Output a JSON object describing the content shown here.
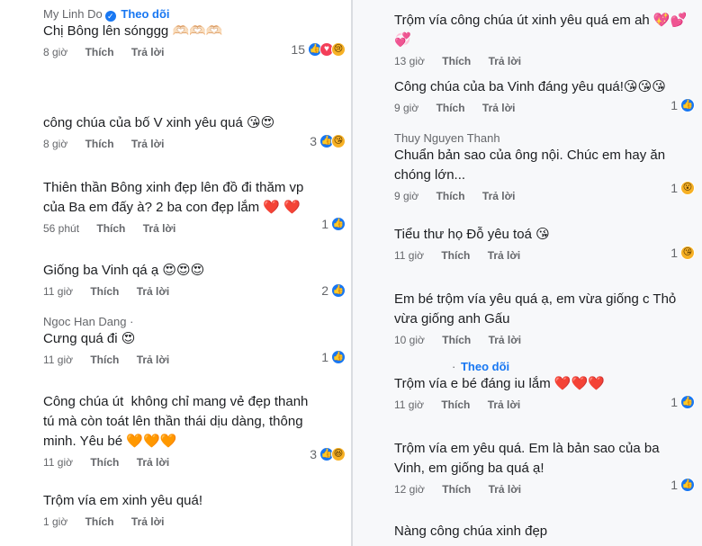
{
  "left": [
    {
      "author": "My Linh Do",
      "verified": true,
      "follow": "Theo dõi",
      "text": "Chị Bông lên sónggg 🫶🏻🫶🏻🫶🏻",
      "time": "8 giờ",
      "like": "Thích",
      "reply": "Trả lời",
      "reaction_count": "15",
      "reactions": [
        "like-icon",
        "love-icon",
        "sad-icon"
      ]
    },
    {
      "text": "công chúa của bố V xinh yêu quá 😘😍",
      "time": "8 giờ",
      "like": "Thích",
      "reply": "Trả lời",
      "reaction_count": "3",
      "reactions": [
        "like-icon",
        "kiss-icon"
      ]
    },
    {
      "text": "Thiên thần Bông xinh đẹp lên đồ đi thăm vp của Ba em đấy à? 2 ba con đẹp lắm ❤️ ❤️",
      "time": "56 phút",
      "like": "Thích",
      "reply": "Trả lời",
      "reaction_count": "1",
      "reactions": [
        "like-icon"
      ]
    },
    {
      "text": "Giống ba Vinh qá ạ 😍😍😍",
      "time": "11 giờ",
      "like": "Thích",
      "reply": "Trả lời",
      "reaction_count": "2",
      "reactions": [
        "like-icon"
      ]
    },
    {
      "author": "Ngoc Han Dang",
      "dot": "·",
      "text": "Cưng quá đi 😍",
      "time": "11 giờ",
      "like": "Thích",
      "reply": "Trả lời",
      "reaction_count": "1",
      "reactions": [
        "like-icon"
      ]
    },
    {
      "text": "Công chúa út  không chỉ mang vẻ đẹp thanh tú mà còn toát lên thần thái dịu dàng, thông minh. Yêu bé 🧡🧡🧡",
      "time": "11 giờ",
      "like": "Thích",
      "reply": "Trả lời",
      "reaction_count": "3",
      "reactions": [
        "like-icon",
        "laugh-icon"
      ]
    },
    {
      "text": "Trộm vía em xinh yêu quá!",
      "time": "1 giờ",
      "like": "Thích",
      "reply": "Trả lời"
    }
  ],
  "right": [
    {
      "text": "Trộm vía công chúa út xinh yêu quá em ah 💖💕💞",
      "time": "13 giờ",
      "like": "Thích",
      "reply": "Trả lời"
    },
    {
      "text": "Công chúa của ba Vinh đáng yêu quá!😘😘😘",
      "time": "9 giờ",
      "like": "Thích",
      "reply": "Trả lời",
      "reaction_count": "1",
      "reactions": [
        "like-icon"
      ]
    },
    {
      "author": "Thuy Nguyen Thanh",
      "text": "Chuẩn bản sao của ông nội. Chúc em hay ăn chóng lớn...",
      "time": "9 giờ",
      "like": "Thích",
      "reply": "Trả lời",
      "reaction_count": "1",
      "reactions": [
        "wow-icon"
      ]
    },
    {
      "text": "Tiểu thư họ Đỗ yêu toá 😘",
      "time": "11 giờ",
      "like": "Thích",
      "reply": "Trả lời",
      "reaction_count": "1",
      "reactions": [
        "kiss-icon"
      ]
    },
    {
      "text": "Em bé trộm vía yêu quá ạ, em vừa giống c Thỏ vừa giống anh Gấu",
      "time": "10 giờ",
      "like": "Thích",
      "reply": "Trả lời"
    },
    {
      "author": "",
      "dot": "·",
      "follow": "Theo dõi",
      "text": "Trộm vía e bé đáng iu lắm ❤️❤️❤️",
      "time": "11 giờ",
      "like": "Thích",
      "reply": "Trả lời",
      "reaction_count": "1",
      "reactions": [
        "like-icon"
      ]
    },
    {
      "text": "Trộm vía em yêu quá. Em là bản sao của ba Vinh, em giống ba quá ạ!",
      "time": "12 giờ",
      "like": "Thích",
      "reply": "Trả lời",
      "reaction_count": "1",
      "reactions": [
        "like-icon"
      ]
    },
    {
      "text": "Nàng công chúa xinh đẹp"
    }
  ]
}
